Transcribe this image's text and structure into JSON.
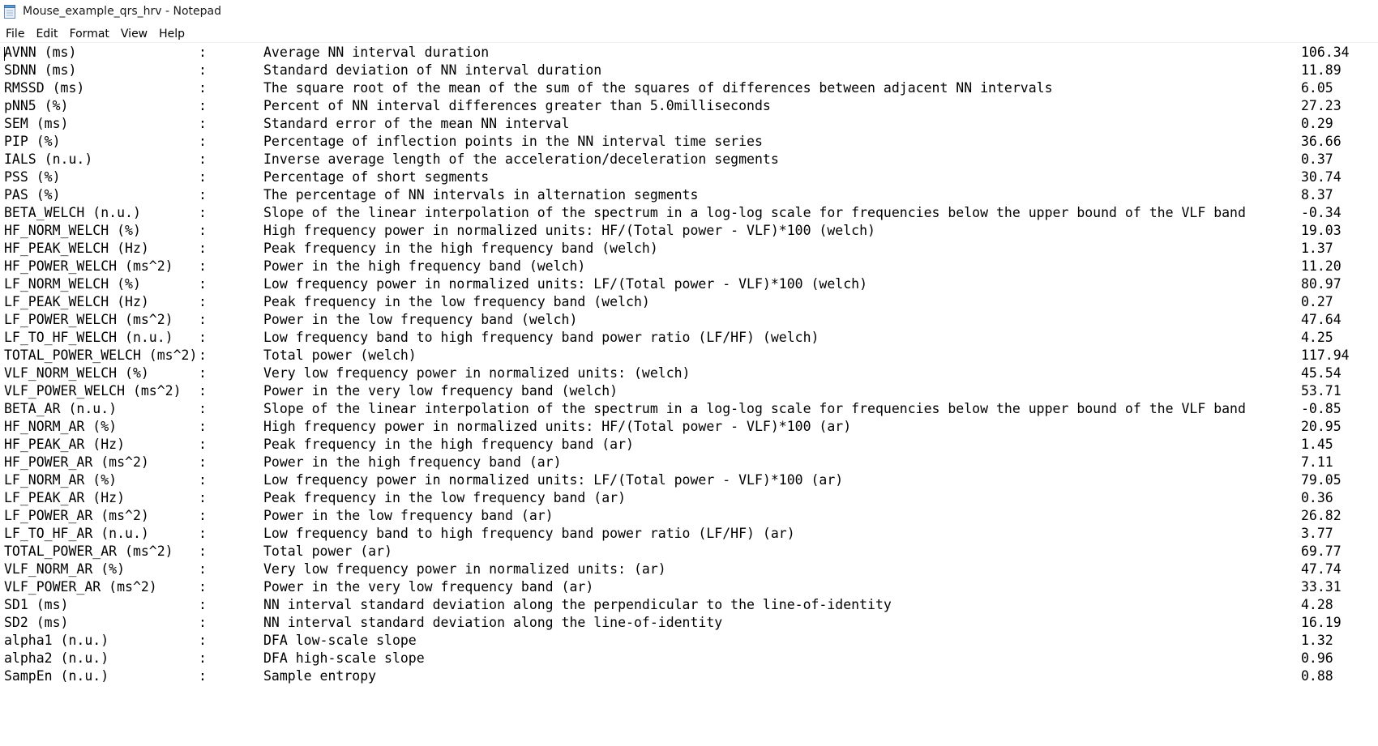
{
  "window": {
    "title": "Mouse_example_qrs_hrv - Notepad",
    "icon": "notepad-icon"
  },
  "menu": [
    "File",
    "Edit",
    "Format",
    "View",
    "Help"
  ],
  "document": {
    "lines": [
      {
        "name": "AVNN (ms)",
        "sep": ":",
        "desc": "Average NN interval duration",
        "value": "106.34"
      },
      {
        "name": "SDNN (ms)",
        "sep": ":",
        "desc": "Standard deviation of NN interval duration",
        "value": "11.89"
      },
      {
        "name": "RMSSD (ms)",
        "sep": ":",
        "desc": "The square root of the mean of the sum of the squares of differences between adjacent NN intervals",
        "value": "6.05"
      },
      {
        "name": "pNN5 (%)",
        "sep": ":",
        "desc": "Percent of NN interval differences greater than 5.0milliseconds",
        "value": "27.23"
      },
      {
        "name": "SEM (ms)",
        "sep": ":",
        "desc": "Standard error of the mean NN interval",
        "value": "0.29"
      },
      {
        "name": "PIP (%)",
        "sep": ":",
        "desc": "Percentage of inflection points in the NN interval time series",
        "value": "36.66"
      },
      {
        "name": "IALS (n.u.)",
        "sep": ":",
        "desc": "Inverse average length of the acceleration/deceleration segments",
        "value": "0.37"
      },
      {
        "name": "PSS (%)",
        "sep": ":",
        "desc": "Percentage of short segments",
        "value": "30.74"
      },
      {
        "name": "PAS (%)",
        "sep": ":",
        "desc": "The percentage of NN intervals in alternation segments",
        "value": "8.37"
      },
      {
        "name": "BETA_WELCH (n.u.)",
        "sep": ":",
        "desc": "Slope of the linear interpolation of the spectrum in a log-log scale for frequencies below the upper bound of the VLF band",
        "value": "-0.34"
      },
      {
        "name": "HF_NORM_WELCH (%)",
        "sep": ":",
        "desc": "High frequency power in normalized units: HF/(Total power - VLF)*100 (welch)",
        "value": "19.03"
      },
      {
        "name": "HF_PEAK_WELCH (Hz)",
        "sep": ":",
        "desc": "Peak frequency in the high frequency band (welch)",
        "value": "1.37"
      },
      {
        "name": "HF_POWER_WELCH (ms^2)",
        "sep": ":",
        "desc": "Power in the high frequency band (welch)",
        "value": "11.20"
      },
      {
        "name": "LF_NORM_WELCH (%)",
        "sep": ":",
        "desc": "Low frequency power in normalized units: LF/(Total power - VLF)*100 (welch)",
        "value": "80.97"
      },
      {
        "name": "LF_PEAK_WELCH (Hz)",
        "sep": ":",
        "desc": "Peak frequency in the low frequency band (welch)",
        "value": "0.27"
      },
      {
        "name": "LF_POWER_WELCH (ms^2)",
        "sep": ":",
        "desc": "Power in the low frequency band (welch)",
        "value": "47.64"
      },
      {
        "name": "LF_TO_HF_WELCH (n.u.)",
        "sep": ":",
        "desc": "Low frequency band to high frequency band power ratio (LF/HF) (welch)",
        "value": "4.25"
      },
      {
        "name": "TOTAL_POWER_WELCH (ms^2)",
        "sep": ":",
        "desc": "Total power (welch)",
        "value": "117.94"
      },
      {
        "name": "VLF_NORM_WELCH (%)",
        "sep": ":",
        "desc": "Very low frequency power in normalized units: (welch)",
        "value": "45.54"
      },
      {
        "name": "VLF_POWER_WELCH (ms^2)",
        "sep": ":",
        "desc": "Power in the very low frequency band (welch)",
        "value": "53.71"
      },
      {
        "name": "BETA_AR (n.u.)",
        "sep": ":",
        "desc": "Slope of the linear interpolation of the spectrum in a log-log scale for frequencies below the upper bound of the VLF band",
        "value": "-0.85"
      },
      {
        "name": "HF_NORM_AR (%)",
        "sep": ":",
        "desc": "High frequency power in normalized units: HF/(Total power - VLF)*100 (ar)",
        "value": "20.95"
      },
      {
        "name": "HF_PEAK_AR (Hz)",
        "sep": ":",
        "desc": "Peak frequency in the high frequency band (ar)",
        "value": "1.45"
      },
      {
        "name": "HF_POWER_AR (ms^2)",
        "sep": ":",
        "desc": "Power in the high frequency band (ar)",
        "value": "7.11"
      },
      {
        "name": "LF_NORM_AR (%)",
        "sep": ":",
        "desc": "Low frequency power in normalized units: LF/(Total power - VLF)*100 (ar)",
        "value": "79.05"
      },
      {
        "name": "LF_PEAK_AR (Hz)",
        "sep": ":",
        "desc": "Peak frequency in the low frequency band (ar)",
        "value": "0.36"
      },
      {
        "name": "LF_POWER_AR (ms^2)",
        "sep": ":",
        "desc": "Power in the low frequency band (ar)",
        "value": "26.82"
      },
      {
        "name": "LF_TO_HF_AR (n.u.)",
        "sep": ":",
        "desc": "Low frequency band to high frequency band power ratio (LF/HF) (ar)",
        "value": "3.77"
      },
      {
        "name": "TOTAL_POWER_AR (ms^2)",
        "sep": ":",
        "desc": "Total power (ar)",
        "value": "69.77"
      },
      {
        "name": "VLF_NORM_AR (%)",
        "sep": ":",
        "desc": "Very low frequency power in normalized units: (ar)",
        "value": "47.74"
      },
      {
        "name": "VLF_POWER_AR (ms^2)",
        "sep": ":",
        "desc": "Power in the very low frequency band (ar)",
        "value": "33.31"
      },
      {
        "name": "SD1 (ms)",
        "sep": ":",
        "desc": "NN interval standard deviation along the perpendicular to the line-of-identity",
        "value": "4.28"
      },
      {
        "name": "SD2 (ms)",
        "sep": ":",
        "desc": "NN interval standard deviation along the line-of-identity",
        "value": "16.19"
      },
      {
        "name": "alpha1 (n.u.)",
        "sep": ":",
        "desc": "DFA low-scale slope",
        "value": "1.32"
      },
      {
        "name": "alpha2 (n.u.)",
        "sep": ":",
        "desc": "DFA high-scale slope",
        "value": "0.96"
      },
      {
        "name": "SampEn (n.u.)",
        "sep": ":",
        "desc": "Sample entropy",
        "value": "0.88"
      }
    ]
  }
}
